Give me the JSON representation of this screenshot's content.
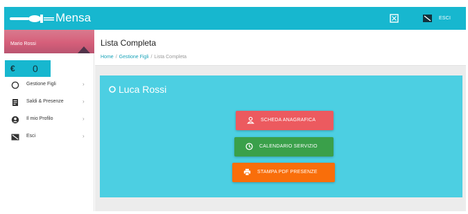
{
  "app": {
    "title": "Mensa",
    "esci_label": "ESCI"
  },
  "colors": {
    "topbar": "#17b7cf",
    "card": "#4ccfe2",
    "scheda": "#ec5a5f",
    "calendario": "#3aa04a",
    "stampa": "#f96e0a"
  },
  "sidebar": {
    "user_name": "Mario Rossi",
    "credit_currency": "€",
    "credit_value": "0",
    "items": [
      {
        "label": "Gestione Figli",
        "icon": "circle-outline-icon"
      },
      {
        "label": "Saldi & Presenze",
        "icon": "document-icon"
      },
      {
        "label": "Il mio Profilo",
        "icon": "account-circle-icon"
      },
      {
        "label": "Esci",
        "icon": "exit-icon"
      }
    ]
  },
  "main": {
    "page_title": "Lista Completa",
    "breadcrumb": [
      "Home",
      "Gestione Figli",
      "Lista Completa"
    ],
    "card": {
      "title": "Luca Rossi",
      "buttons": [
        {
          "label": "SCHEDA ANAGRAFICA",
          "icon": "person-icon"
        },
        {
          "label": "CALENDARIO SERVIZIO",
          "icon": "clock-icon"
        },
        {
          "label": "STAMPA PDF PRESENZE",
          "icon": "printer-icon"
        }
      ]
    }
  }
}
